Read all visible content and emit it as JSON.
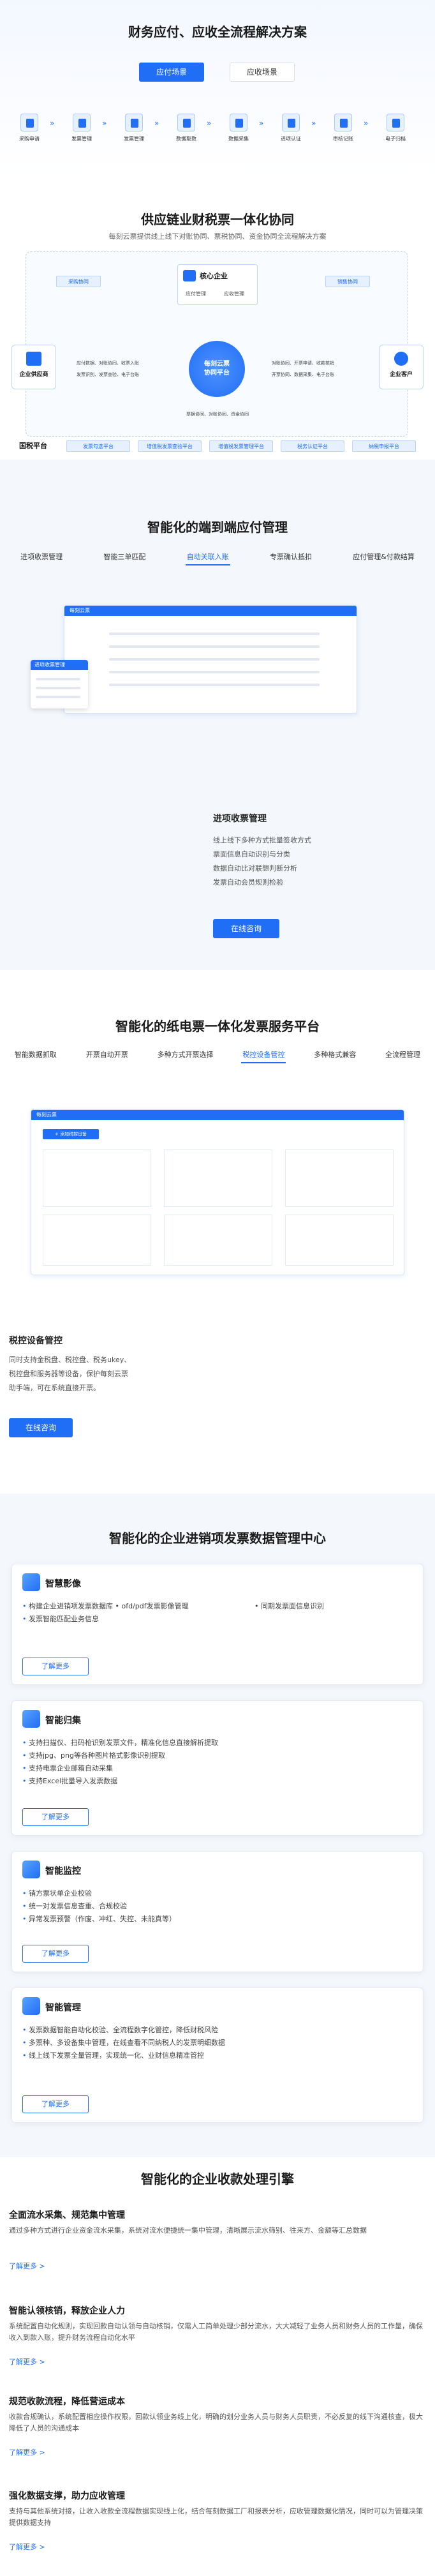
{
  "s1": {
    "title": "财务应付、应收全流程解决方案",
    "tab_active": "应付场景",
    "tab_other": "应收场景",
    "steps": [
      "采购申请",
      "发票管理",
      "发票管理",
      "数据取数",
      "数据采集",
      "进项认证",
      "审核记账",
      "电子归档"
    ]
  },
  "s2": {
    "title": "供应链业财税票一体化协同",
    "subtitle": "每刻云票提供线上线下对账协同、票税协同、资金协同全流程解决方案",
    "core": "核心企业",
    "platform_line1": "每刻云票",
    "platform_line2": "协同平台",
    "left_node": "企业供应商",
    "right_node": "企业客户",
    "tag_left_top": "采购协同",
    "tag_right_top": "销售协同",
    "core_sub1": "应付管理",
    "core_sub2": "应收管理",
    "left_text1": "应付数据、对账协同、收票入账",
    "left_text2": "发票识别、发票查验、电子台账",
    "right_text1": "对账协同、开票申请、收款核销",
    "right_text2": "开票协同、数据采集、电子台账",
    "bottom_text": "票据协同、对账协同、资金协同",
    "tax_label": "国税平台",
    "tax_pills": [
      "发票勾选平台",
      "增值税发票查验平台",
      "增值税发票管理平台",
      "税务认证平台",
      "纳税申报平台"
    ]
  },
  "s3": {
    "title": "智能化的端到端应付管理",
    "tabs": [
      "进项收票管理",
      "智能三单匹配",
      "自动关联入账",
      "专票确认抵扣",
      "应付管理&付款结算"
    ],
    "active_tab": 2,
    "mock_brand": "每刻云票",
    "pop_title": "进项收票管理",
    "feature_title": "进项收票管理",
    "features": [
      "线上线下多种方式批量签收方式",
      "票面信息自动识别与分类",
      "数据自动比对联想判断分析",
      "发票自动会员规则检验"
    ],
    "btn": "在线咨询"
  },
  "s4": {
    "title": "智能化的纸电票一体化发票服务平台",
    "tabs": [
      "智能数据抓取",
      "开票自动开票",
      "多种方式开票选择",
      "税控设备管控",
      "多种格式兼容",
      "全流程管理"
    ],
    "active_tab": 3,
    "mock_brand": "每刻云票",
    "mock_btn": "+ 添加税控设备",
    "feature_title": "税控设备管控",
    "desc": [
      "同时支持金税盘、税控盘、税务ukey、",
      "税控盘和服务器等设备，保护每刻云票",
      "助手端，可在系统直接开票。"
    ],
    "btn": "在线咨询"
  },
  "s5": {
    "title": "智能化的企业进销项发票数据管理中心",
    "more": "了解更多",
    "cards": [
      {
        "title": "智慧影像",
        "items": [
          "构建企业进销项发票数据库 • ofd/pdf发票影像管理",
          "发票智能匹配业务信息"
        ],
        "extra": "• 同期发票面信息识别"
      },
      {
        "title": "智能归集",
        "items": [
          "支持扫描仪、扫码枪识别发票文件，精准化信息直接解析提取",
          "支持jpg、png等各种图片格式影像识别提取",
          "支持电票企业邮箱自动采集",
          "支持Excel批量导入发票数据"
        ]
      },
      {
        "title": "智能监控",
        "items": [
          "销方票状单企业校验",
          "统一对发票信息查重、合规校验",
          "异常发票预警（作废、冲红、失控、未能真等）"
        ]
      },
      {
        "title": "智能管理",
        "items": [
          "发票数据智能自动化校验、全流程数字化管控，降低财税风险",
          "多票种、多设备集中管理，在线查看不同纳税人的发票明细数据",
          "线上线下发票全量管理，实现统一化、业财信息精准管控"
        ]
      }
    ]
  },
  "s6": {
    "title": "智能化的企业收款处理引擎",
    "more": "了解更多 >",
    "rows": [
      {
        "title": "全面流水采集、规范集中管理",
        "desc": "通过多种方式进行企业资金流水采集，系统对流水便捷统一集中管理，清晰展示流水筛别、往来方、金额等汇总数据"
      },
      {
        "title": "智能认领核销，释放企业人力",
        "desc": "系统配置自动化规则，实现回款自动认领与自动核销，仅需人工简单处理少部分流水，大大减轻了业务人员和财务人员的工作量，确保收入到款入账，提升财务流程自动化水平"
      },
      {
        "title": "规范收款流程，降低营运成本",
        "desc": "收款合规确认，系统配置相应操作权限，回款认领业务线上化，明确的划分业务人员与财务人员职责，不必反复的线下沟通核查，极大降低了人员的沟通成本"
      },
      {
        "title": "强化数据支撑，助力应收管理",
        "desc": "支持与其他系统对接，让收入收款全流程数据实现线上化，结合每刻数据工厂和报表分析，应收管理数据化情况，同时可以为管理决策提供数据支持"
      }
    ]
  }
}
